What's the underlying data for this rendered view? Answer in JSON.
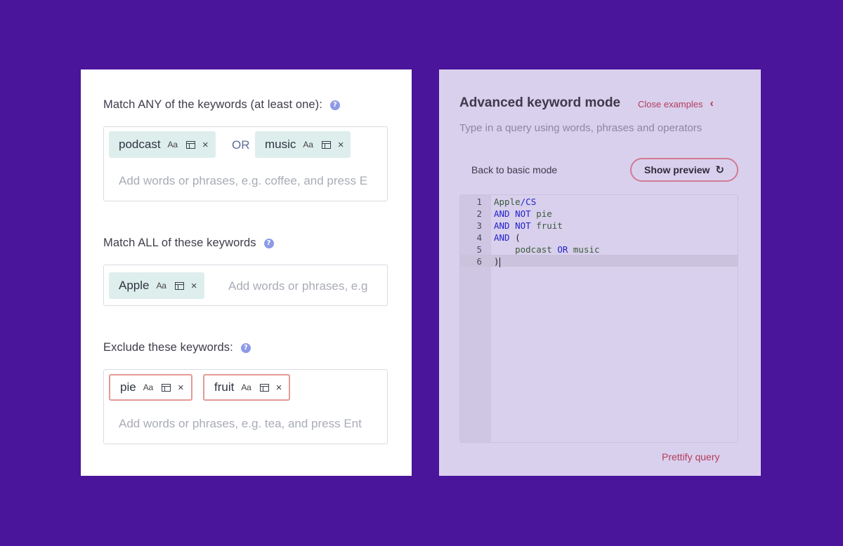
{
  "any_section": {
    "label": "Match ANY of the keywords (at least one):",
    "chips": [
      {
        "text": "podcast",
        "case_label": "Aa",
        "remove_label": "×"
      },
      {
        "text": "music",
        "case_label": "Aa",
        "remove_label": "×"
      }
    ],
    "or_label": "OR",
    "placeholder": "Add words or phrases, e.g. coffee, and press E"
  },
  "all_section": {
    "label": "Match ALL of these keywords",
    "chips": [
      {
        "text": "Apple",
        "case_label": "Aa",
        "remove_label": "×"
      }
    ],
    "placeholder": "Add words or phrases, e.g"
  },
  "exclude_section": {
    "label": "Exclude these keywords:",
    "chips": [
      {
        "text": "pie",
        "case_label": "Aa",
        "remove_label": "×"
      },
      {
        "text": "fruit",
        "case_label": "Aa",
        "remove_label": "×"
      }
    ],
    "placeholder": "Add words or phrases, e.g. tea, and press Ent"
  },
  "help_glyph": "?",
  "advanced": {
    "title": "Advanced keyword mode",
    "close_examples": "Close examples",
    "close_glyph": "‹",
    "subtitle": "Type in a query using words, phrases and operators",
    "back_button": "Back to basic mode",
    "preview_button": "Show preview",
    "refresh_glyph": "↻",
    "prettify": "Prettify query",
    "editor": {
      "line_numbers": [
        "1",
        "2",
        "3",
        "4",
        "5",
        "6"
      ],
      "lines": [
        [
          {
            "t": "Apple",
            "k": "w"
          },
          {
            "t": "/CS",
            "k": "k"
          }
        ],
        [
          {
            "t": "AND NOT ",
            "k": "k"
          },
          {
            "t": "pie",
            "k": "w"
          }
        ],
        [
          {
            "t": "AND NOT ",
            "k": "k"
          },
          {
            "t": "fruit",
            "k": "w"
          }
        ],
        [
          {
            "t": "AND ",
            "k": "k"
          },
          {
            "t": "(",
            "k": "p"
          }
        ],
        [
          {
            "t": "    podcast ",
            "k": "w"
          },
          {
            "t": "OR",
            "k": "k"
          },
          {
            "t": " music",
            "k": "w"
          }
        ],
        [
          {
            "t": ")",
            "k": "p"
          }
        ]
      ],
      "active_line": 6
    }
  },
  "colors": {
    "page_bg": "#4a149b",
    "include_chip_bg": "#deeeed",
    "exclude_chip_border": "#e39a96",
    "accent": "#b33c5c",
    "help_icon": "#8d9ae6",
    "keyword_blue": "#2323c9"
  }
}
